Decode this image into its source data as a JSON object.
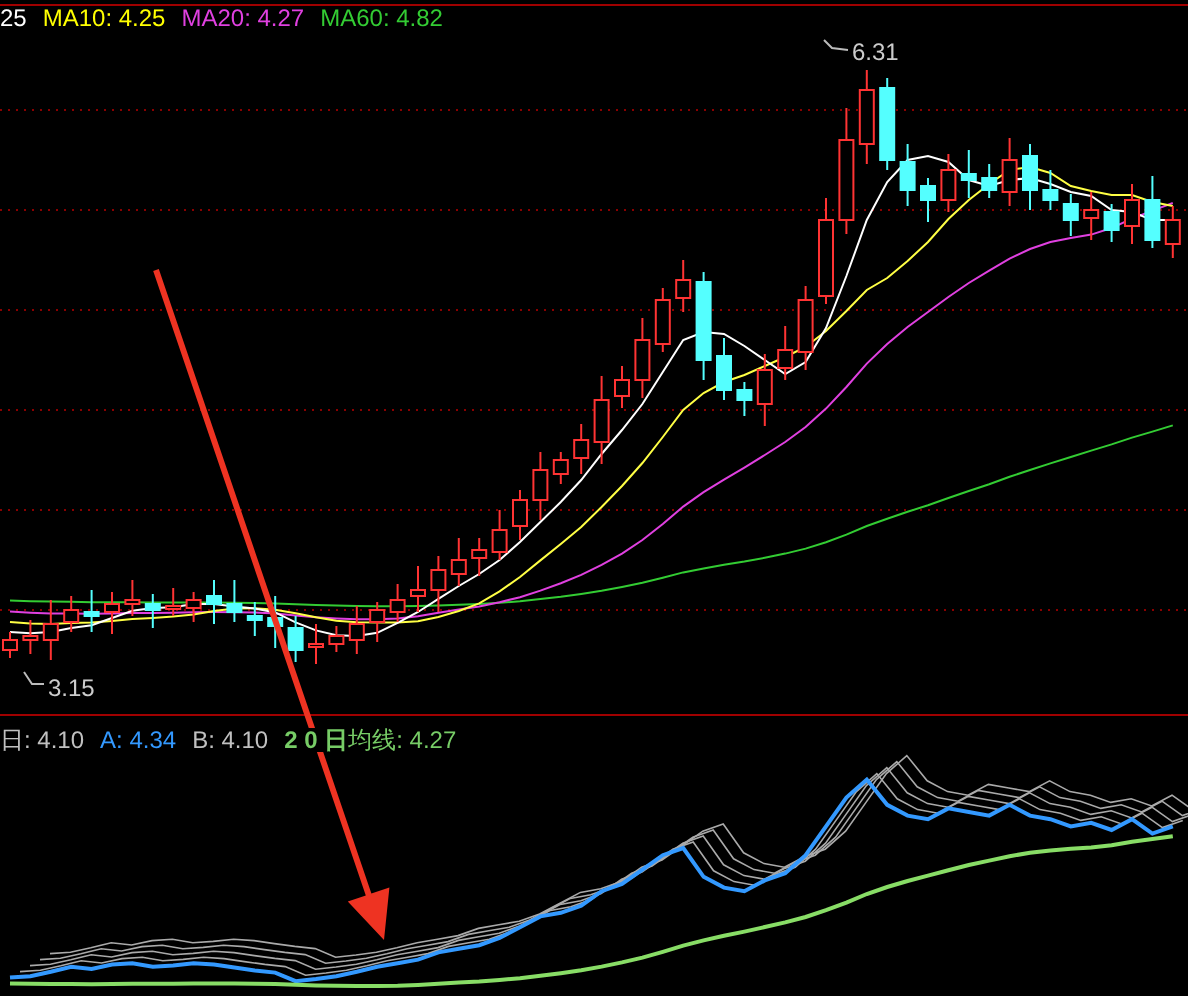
{
  "price_legend": [
    {
      "text": "25",
      "color": "#ffffff"
    },
    {
      "text": "MA10: 4.25",
      "color": "#ffff00"
    },
    {
      "text": "MA20: 4.27",
      "color": "#e040e0"
    },
    {
      "text": "MA60: 4.82",
      "color": "#33cc33"
    }
  ],
  "high_label": "6.31",
  "low_label": "3.15",
  "indicator_legend": [
    {
      "text": "日: 4.10",
      "color": "#c0c0c0"
    },
    {
      "text": "A: 4.34",
      "color": "#3399ff"
    },
    {
      "text": "B: 4.10",
      "color": "#c0c0c0"
    },
    {
      "text": "**2 0 日**均线: 4.27",
      "color": "#77cc66"
    }
  ]
}
